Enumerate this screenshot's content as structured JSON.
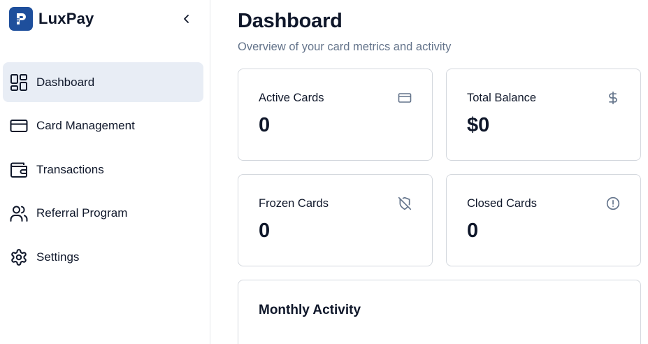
{
  "brand": {
    "name": "LuxPay",
    "logo_icon": "luxpay-logo-icon",
    "accent": "#1e4f9c"
  },
  "sidebar": {
    "collapse_icon": "chevron-left-icon",
    "items": [
      {
        "label": "Dashboard",
        "icon": "layout-grid-icon",
        "active": true
      },
      {
        "label": "Card Management",
        "icon": "credit-card-icon",
        "active": false
      },
      {
        "label": "Transactions",
        "icon": "wallet-icon",
        "active": false
      },
      {
        "label": "Referral Program",
        "icon": "users-icon",
        "active": false
      },
      {
        "label": "Settings",
        "icon": "gear-icon",
        "active": false
      }
    ]
  },
  "header": {
    "title": "Dashboard",
    "subtitle": "Overview of your card metrics and activity"
  },
  "metrics": [
    {
      "label": "Active Cards",
      "value": "0",
      "icon": "credit-card-icon"
    },
    {
      "label": "Total Balance",
      "value": "$0",
      "icon": "dollar-icon"
    },
    {
      "label": "Frozen Cards",
      "value": "0",
      "icon": "shield-off-icon"
    },
    {
      "label": "Closed Cards",
      "value": "0",
      "icon": "alert-circle-icon"
    }
  ],
  "activity": {
    "title": "Monthly Activity"
  },
  "colors": {
    "text": "#0f172a",
    "muted": "#64748b",
    "active_bg": "#e8edf5",
    "border": "#d4d8de"
  }
}
